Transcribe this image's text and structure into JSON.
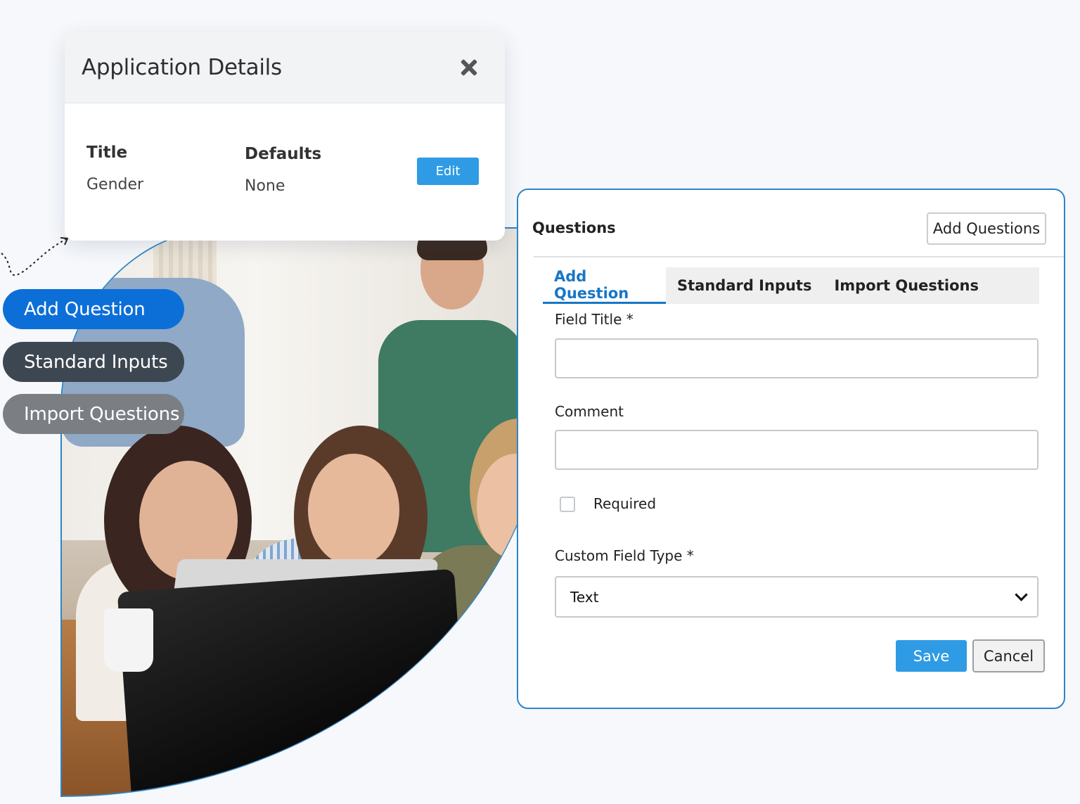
{
  "application_details": {
    "title": "Application Details",
    "columns": [
      {
        "header": "Title",
        "value": "Gender"
      },
      {
        "header": "Defaults",
        "value": "None"
      }
    ],
    "edit_label": "Edit"
  },
  "side_pills": {
    "add_question": "Add Question",
    "standard_inputs": "Standard Inputs",
    "import_questions": "Import Questions"
  },
  "questions_panel": {
    "title": "Questions",
    "add_questions_label": "Add Questions",
    "tabs": [
      {
        "label": "Add Question",
        "active": true
      },
      {
        "label": "Standard Inputs",
        "active": false
      },
      {
        "label": "Import Questions",
        "active": false
      }
    ],
    "field_title_label": "Field Title *",
    "field_title_value": "",
    "comment_label": "Comment",
    "comment_value": "",
    "required_label": "Required",
    "required_checked": false,
    "custom_field_type_label": "Custom Field Type *",
    "custom_field_type_value": "Text",
    "save_label": "Save",
    "cancel_label": "Cancel"
  },
  "colors": {
    "accent": "#2f9be4",
    "active_tab": "#1677c6",
    "pill_add": "#0c6fd8",
    "pill_standard": "#3d4752",
    "pill_import": "#7b7f84",
    "panel_border": "#2c85c8"
  }
}
